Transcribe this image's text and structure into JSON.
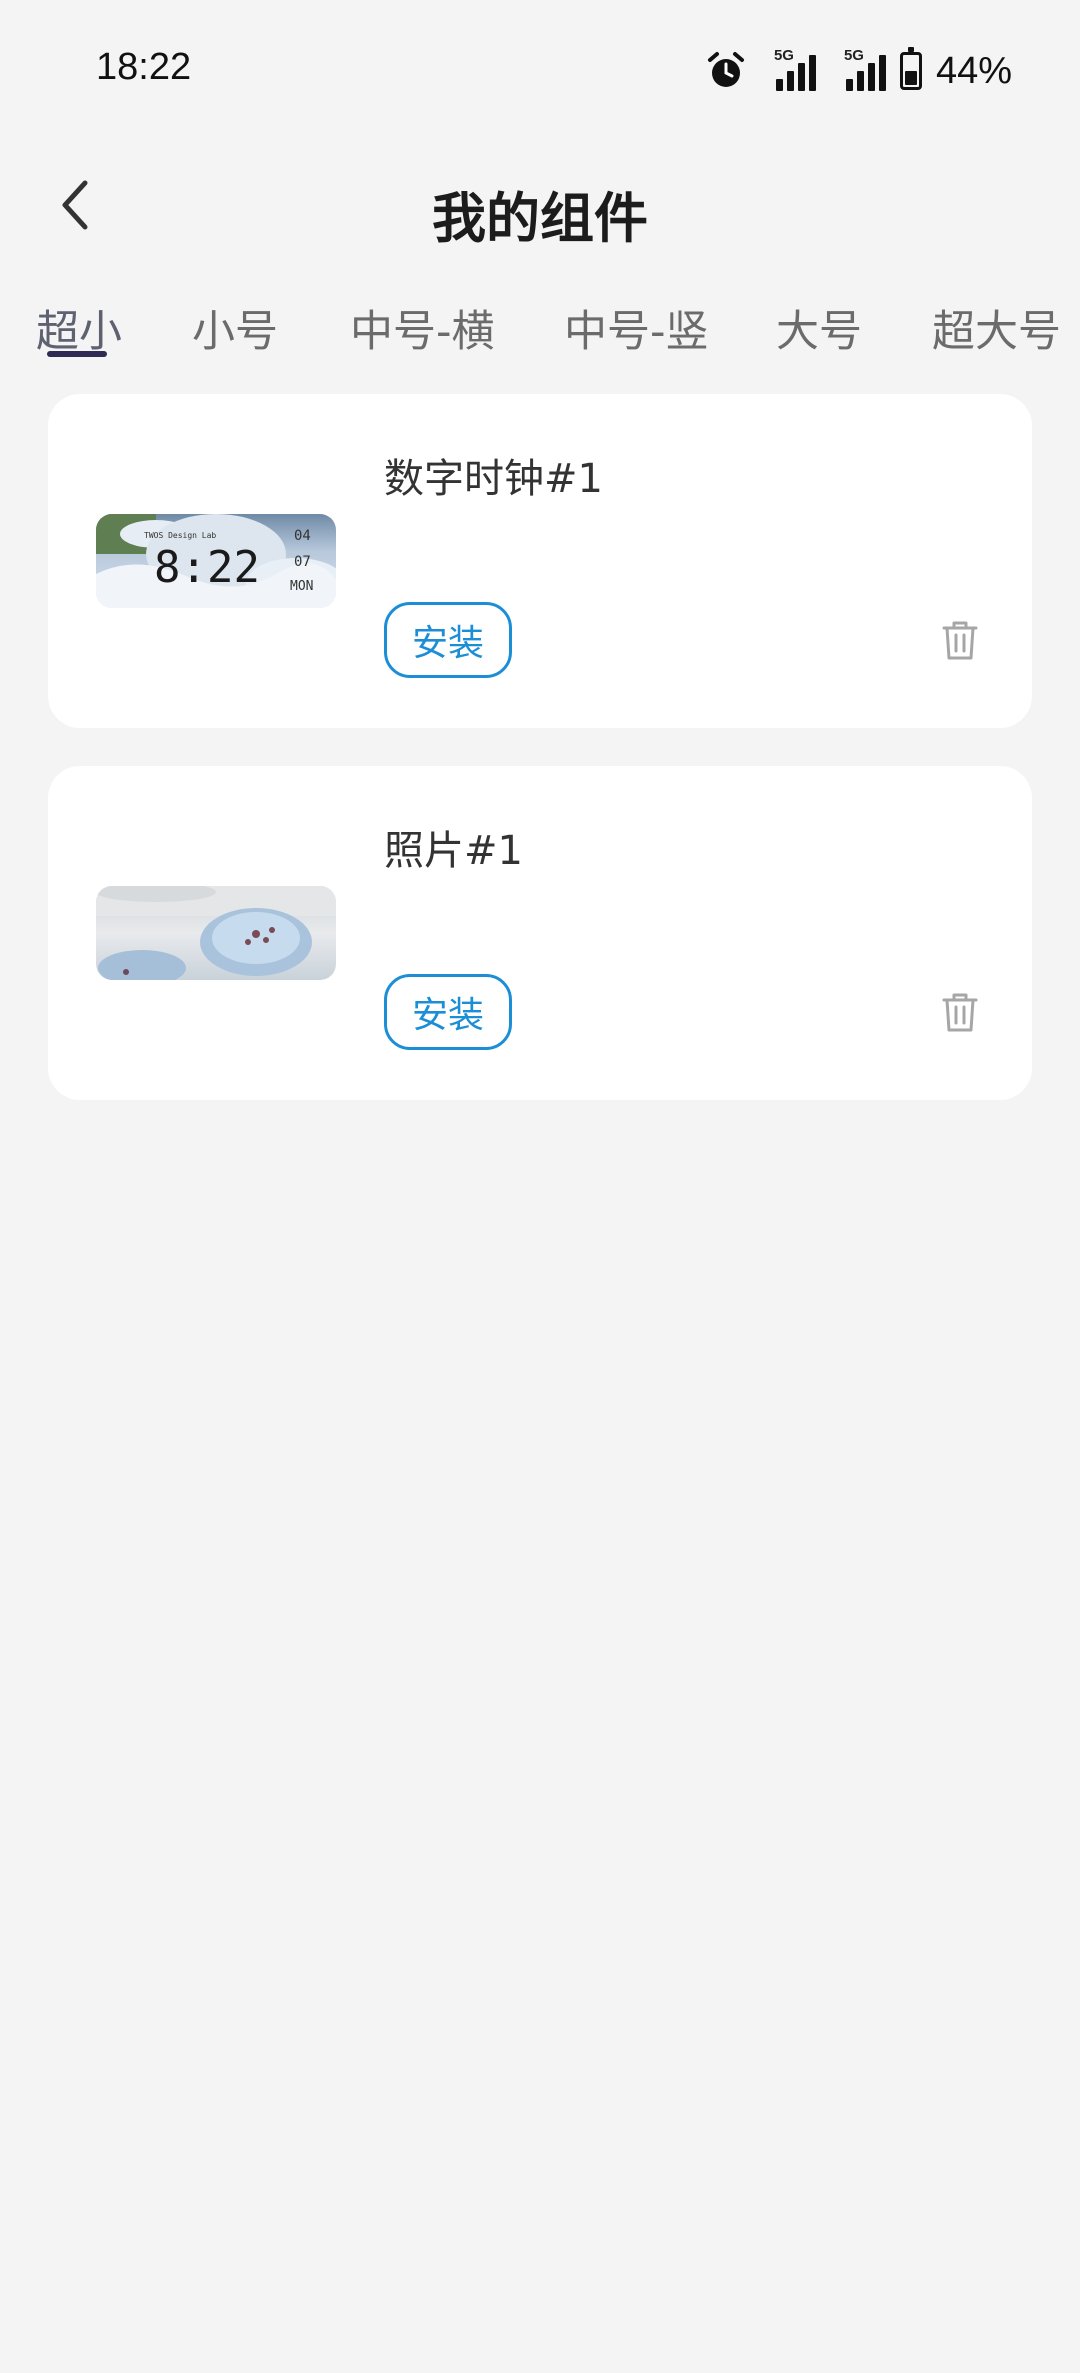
{
  "status_bar": {
    "time": "18:22",
    "battery_percent": "44%",
    "network_label_1": "5G",
    "network_label_2": "5G"
  },
  "header": {
    "title": "我的组件"
  },
  "tabs": [
    {
      "label": "超小",
      "active": true
    },
    {
      "label": "小号"
    },
    {
      "label": "中号-横"
    },
    {
      "label": "中号-竖"
    },
    {
      "label": "大号"
    },
    {
      "label": "超大号"
    }
  ],
  "widgets": [
    {
      "name": "数字时钟#1",
      "install_label": "安装",
      "thumbnail": {
        "time": "8:22",
        "month": "04",
        "day": "07",
        "weekday": "MON",
        "brand": "TWOS Design Lab"
      }
    },
    {
      "name": "照片#1",
      "install_label": "安装"
    }
  ],
  "colors": {
    "accent": "#1b8ed6",
    "background": "#f4f4f4",
    "tab_indicator": "#2d2a55"
  },
  "icons": {
    "back": "chevron-left-icon",
    "delete": "trash-icon",
    "alarm": "alarm-icon",
    "battery": "battery-icon"
  }
}
